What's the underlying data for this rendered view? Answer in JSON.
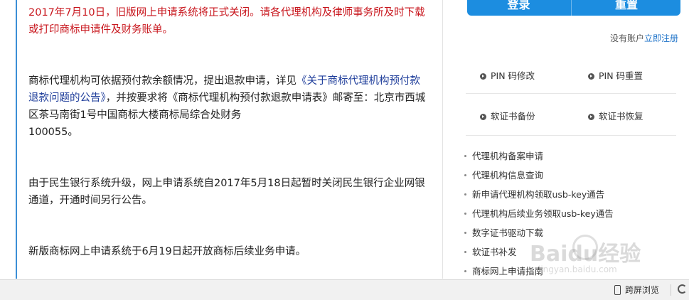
{
  "notices": {
    "closure_notice": "2017年7月10日，旧版网上申请系统将正式关闭。请各代理机构及律师事务所及时下载或打印商标申请件及财务账单。",
    "refund_pre": "商标代理机构可依据预付款余额情况，提出退款申请，详见",
    "refund_link": "《关于商标代理机构预付款退款问题的公告》",
    "refund_mid": "，并按要求将《商标代理机构预付款退款申请表》邮寄至：北京市西城区茶马南街1号中国商标大楼商标局综合处财务",
    "refund_zip": "100055。",
    "bank_notice": "由于民生银行系统升级，网上申请系统自2017年5月18日起暂时关闭民生银行企业网银通道，开通时间另行公告。",
    "new_system_notice": "新版商标网上申请系统于6月19日起开放商标后续业务申请。"
  },
  "auth": {
    "login_label": "登录",
    "reset_label": "重置",
    "no_account": "没有账户",
    "register_link": "立即注册"
  },
  "tools": {
    "pin_modify": "PIN 码修改",
    "pin_reset": "PIN 码重置",
    "cert_backup": "软证书备份",
    "cert_restore": "软证书恢复"
  },
  "links": [
    "代理机构备案申请",
    "代理机构信息查询",
    "新申请代理机构领取usb-key通告",
    "代理机构后续业务领取usb-key通告",
    "数字证书驱动下载",
    "软证书补发",
    "商标网上申请指南"
  ],
  "watermark": {
    "brand": "Baidu经验",
    "url": "jingyan.baidu.com"
  },
  "statusbar": {
    "cross_screen": "跨屏浏览"
  },
  "colors": {
    "accent_blue": "#1c8de0",
    "notice_red": "#c8161d",
    "link_blue": "#1d3c9a"
  }
}
